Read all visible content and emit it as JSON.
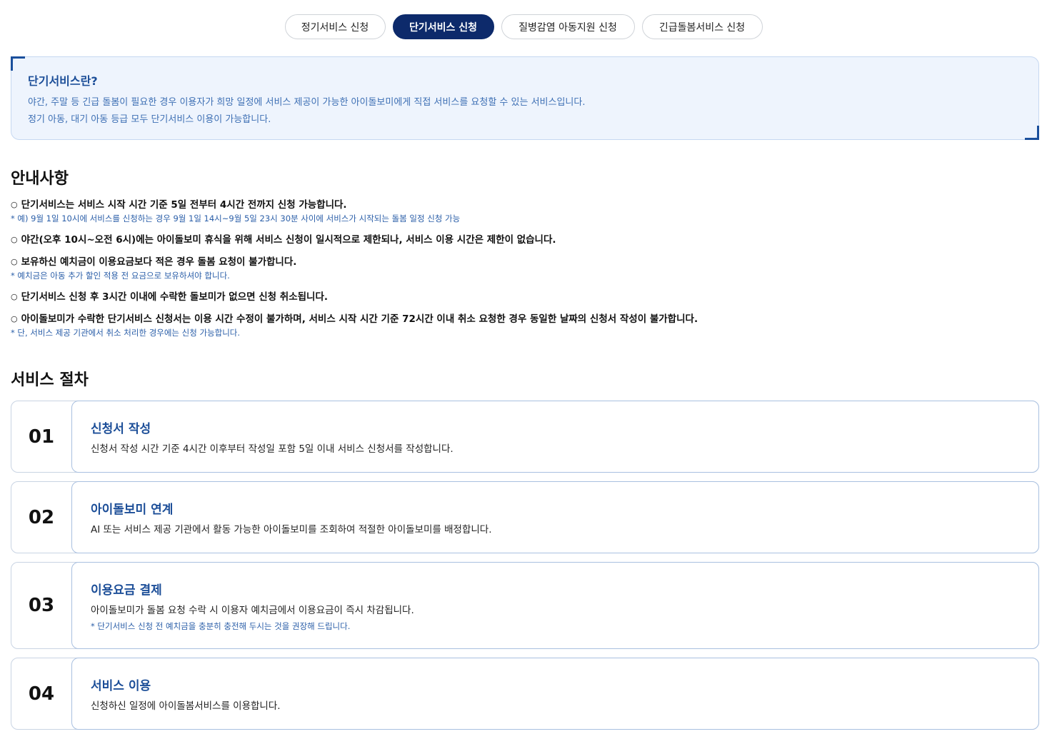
{
  "tabs": [
    {
      "label": "정기서비스 신청",
      "active": false
    },
    {
      "label": "단기서비스 신청",
      "active": true
    },
    {
      "label": "질병감염 아동지원 신청",
      "active": false
    },
    {
      "label": "긴급돌봄서비스 신청",
      "active": false
    }
  ],
  "intro": {
    "title": "단기서비스란?",
    "line1": "야간, 주말 등 긴급 돌봄이 필요한 경우 이용자가 희망 일정에 서비스 제공이 가능한 아이돌보미에게 직접 서비스를 요청할 수 있는 서비스입니다.",
    "line2": "정기 아동, 대기 아동 등급 모두 단기서비스 이용이 가능합니다."
  },
  "notices": {
    "title": "안내사항",
    "bullet": "○",
    "items": [
      {
        "text": "단기서비스는 서비스 시작 시간 기준 5일 전부터 4시간 전까지 신청 가능합니다.",
        "sub": "* 예) 9월 1일 10시에 서비스를 신청하는 경우 9월 1일 14시~9월 5일 23시 30분 사이에 서비스가 시작되는 돌봄 일정 신청 가능"
      },
      {
        "text": "야간(오후 10시~오전 6시)에는 아이돌보미 휴식을 위해 서비스 신청이 일시적으로 제한되나, 서비스 이용 시간은 제한이 없습니다.",
        "sub": ""
      },
      {
        "text": "보유하신 예치금이 이용요금보다 적은 경우 돌봄 요청이 불가합니다.",
        "sub": "* 예치금은 아동 추가 할인 적용 전 요금으로 보유하셔야 합니다."
      },
      {
        "text": "단기서비스 신청 후 3시간 이내에 수락한 돌보미가 없으면 신청 취소됩니다.",
        "sub": ""
      },
      {
        "text": "아이돌보미가 수락한 단기서비스 신청서는 이용 시간 수정이 불가하며, 서비스 시작 시간 기준 72시간 이내 취소 요청한 경우 동일한 날짜의 신청서 작성이 불가합니다.",
        "sub": "* 단, 서비스 제공 기관에서 취소 처리한 경우에는 신청 가능합니다."
      }
    ]
  },
  "procedure": {
    "title": "서비스 절차",
    "steps": [
      {
        "num": "01",
        "title": "신청서 작성",
        "desc": "신청서 작성 시간 기준 4시간 이후부터 작성일 포함 5일 이내 서비스 신청서를 작성합니다.",
        "note": ""
      },
      {
        "num": "02",
        "title": "아이돌보미 연계",
        "desc": "AI 또는 서비스 제공 기관에서 활동 가능한 아이돌보미를 조회하여 적절한 아이돌보미를 배정합니다.",
        "note": ""
      },
      {
        "num": "03",
        "title": "이용요금 결제",
        "desc": "아이돌보미가 돌봄 요청 수락 시 이용자 예치금에서 이용요금이 즉시 차감됩니다.",
        "note": "* 단기서비스 신청 전 예치금을 충분히 충전해 두시는 것을 권장해 드립니다."
      },
      {
        "num": "04",
        "title": "서비스 이용",
        "desc": "신청하신 일정에 아이돌봄서비스를 이용합니다.",
        "note": ""
      }
    ]
  }
}
